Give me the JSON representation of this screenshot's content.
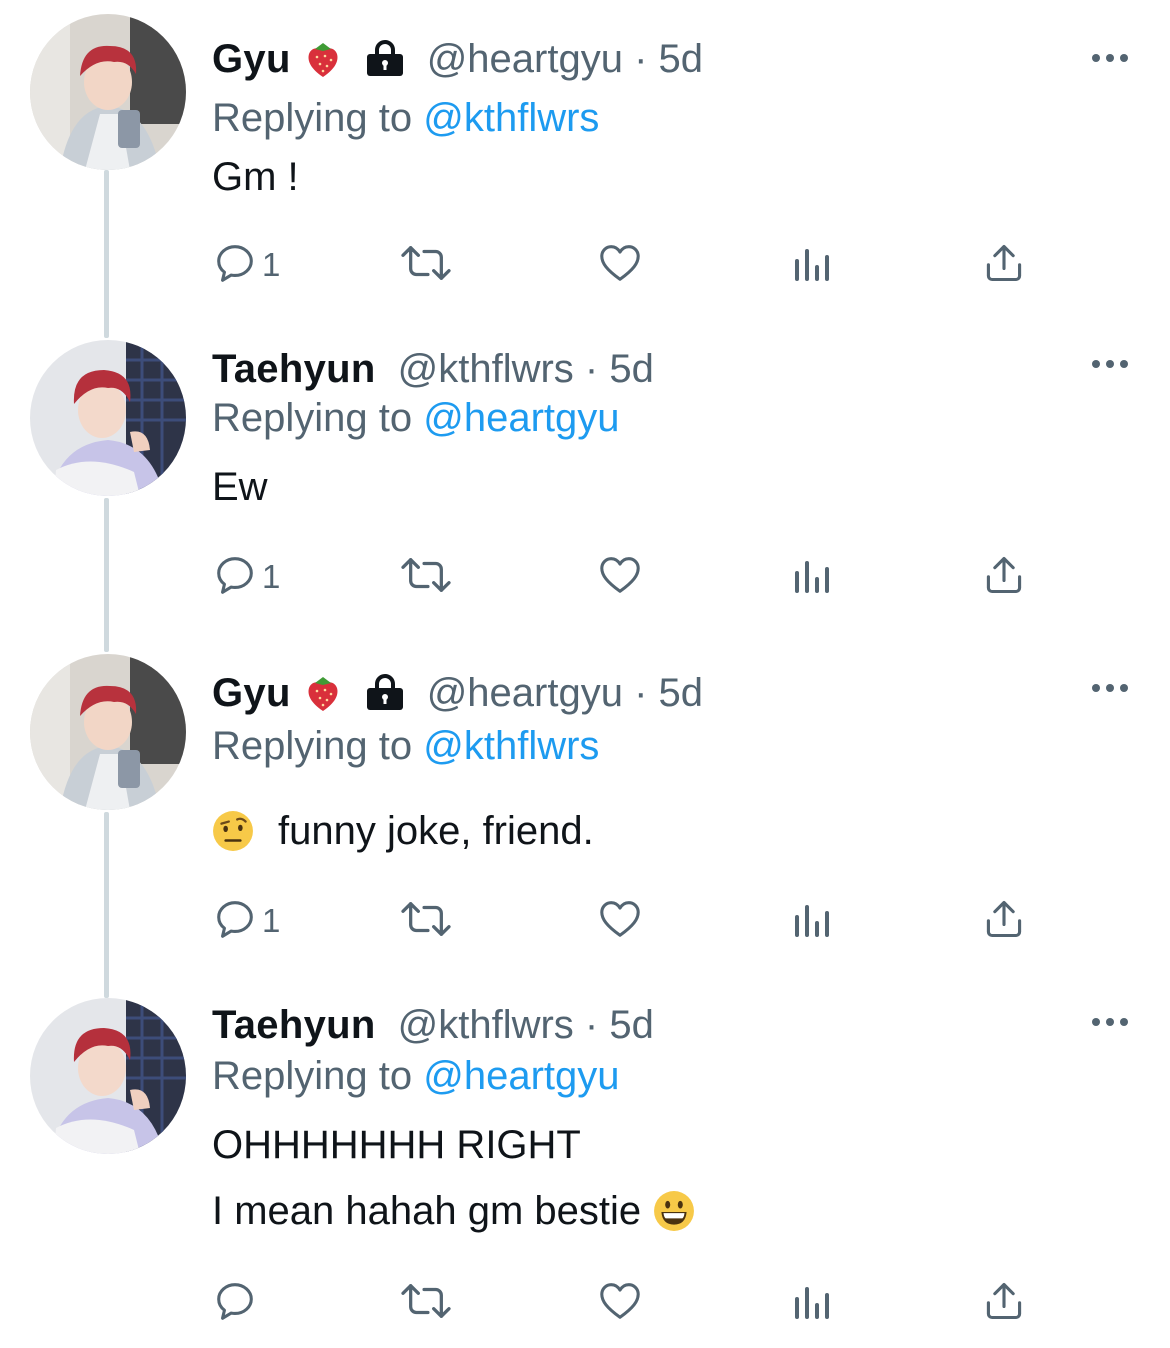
{
  "colors": {
    "text": "#0f1419",
    "secondary": "#536471",
    "link": "#1d9bf0",
    "thread_line": "#cfd9de"
  },
  "tweets": [
    {
      "name": "Gyu",
      "has_badges": true,
      "handle_meta": "@heartgyu · 5d",
      "replying_prefix": "Replying to",
      "replying_to": "@kthflwrs",
      "text_lines": [
        "Gm !"
      ],
      "reply_count": "1",
      "avatar": "gyu"
    },
    {
      "name": "Taehyun",
      "has_badges": false,
      "handle_meta": "@kthflwrs · 5d",
      "replying_prefix": "Replying to",
      "replying_to": "@heartgyu",
      "text_lines": [
        "Ew"
      ],
      "reply_count": "1",
      "avatar": "taehyun"
    },
    {
      "name": "Gyu",
      "has_badges": true,
      "handle_meta": "@heartgyu · 5d",
      "replying_prefix": "Replying to",
      "replying_to": "@kthflwrs",
      "text_lines": [
        "funny joke, friend."
      ],
      "leading_emoji": "face-with-raised-eyebrow",
      "reply_count": "1",
      "avatar": "gyu"
    },
    {
      "name": "Taehyun",
      "has_badges": false,
      "handle_meta": "@kthflwrs · 5d",
      "replying_prefix": "Replying to",
      "replying_to": "@heartgyu",
      "text_lines": [
        "OHHHHHHH RIGHT",
        "I mean hahah gm bestie"
      ],
      "trailing_emoji": "grinning-face",
      "reply_count": "",
      "avatar": "taehyun"
    }
  ],
  "icons": {
    "reply": "reply-icon",
    "retweet": "retweet-icon",
    "like": "heart-icon",
    "views": "views-icon",
    "share": "share-icon",
    "more": "more-icon",
    "lock": "lock-icon",
    "strawberry": "strawberry-icon"
  }
}
